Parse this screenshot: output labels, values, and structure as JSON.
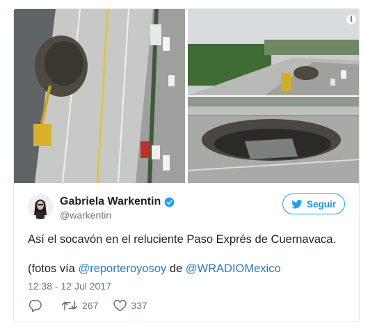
{
  "tweet": {
    "author_name": "Gabriela Warkentin",
    "author_handle": "@warkentin",
    "follow_label": "Seguir",
    "text_line1": "Así el socavón en el reluciente Paso Exprés de Cuernavaca.",
    "text_prefix": "(fotos vía ",
    "mention1": "@reporteroyosoy",
    "text_middle": " de ",
    "mention2": "@WRADIOMexico",
    "timestamp": "12:38 - 12 Jul 2017",
    "retweets": "267",
    "likes": "337"
  },
  "icons": {
    "info": "info-icon",
    "verified": "verified-badge-icon",
    "twitter_bird": "twitter-bird-icon",
    "reply": "reply-icon",
    "retweet": "retweet-icon",
    "like": "heart-icon"
  },
  "colors": {
    "twitter_blue": "#1da1f2",
    "link": "#2b7bb9",
    "muted": "#697882"
  }
}
